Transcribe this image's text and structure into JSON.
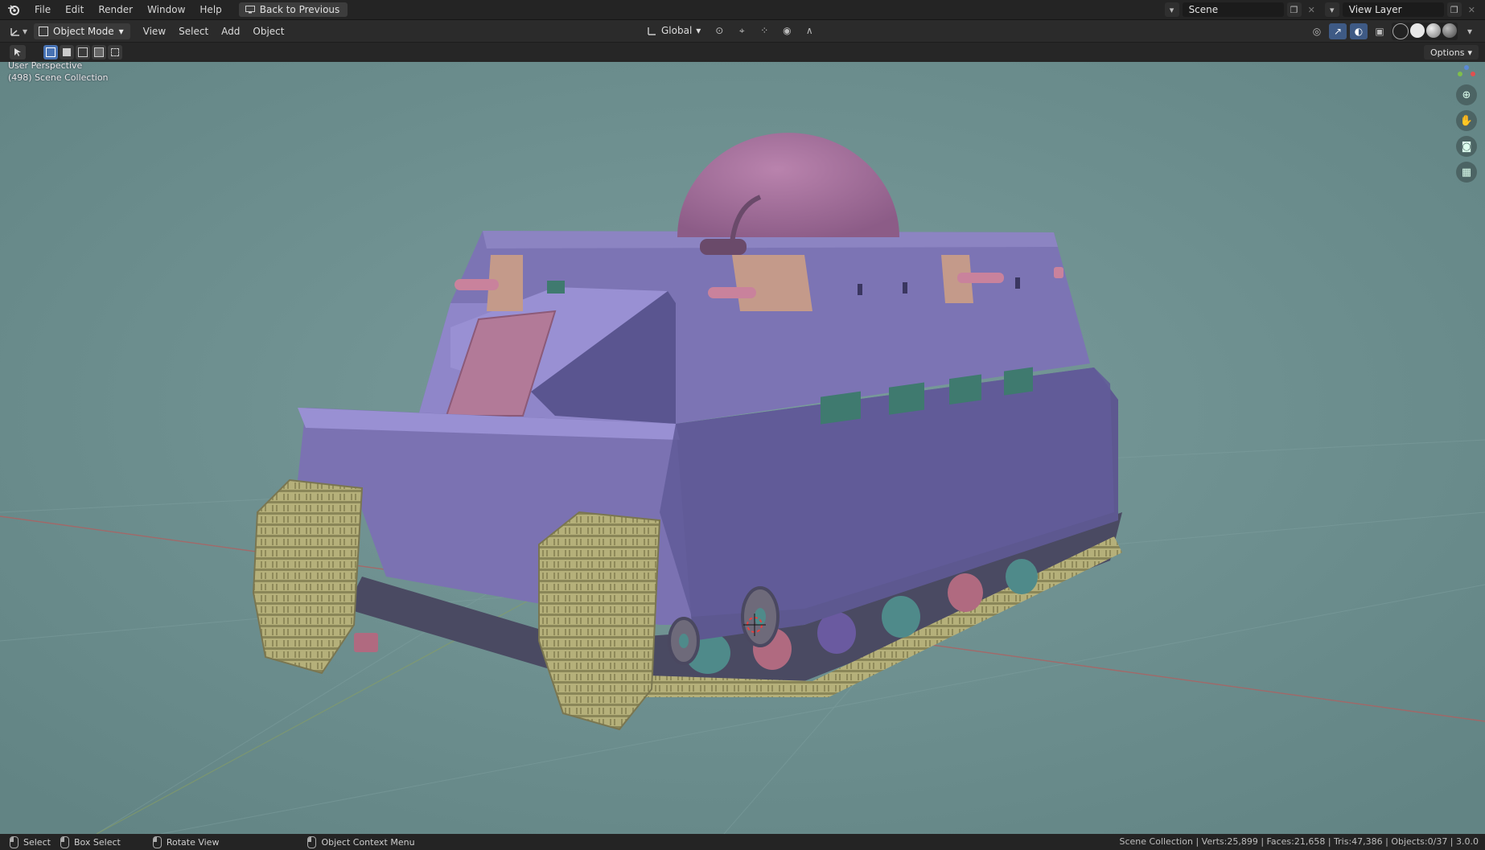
{
  "topbar": {
    "menus": [
      "File",
      "Edit",
      "Render",
      "Window",
      "Help"
    ],
    "back_button": "Back to Previous",
    "scene": "Scene",
    "view_layer": "View Layer"
  },
  "viewport_header": {
    "mode": "Object Mode",
    "menus": [
      "View",
      "Select",
      "Add",
      "Object"
    ],
    "orientation": "Global"
  },
  "tool_header": {
    "options": "Options"
  },
  "viewport": {
    "perspective": "User Perspective",
    "collection": "(498) Scene Collection",
    "background": "#6d8f8f"
  },
  "statusbar": {
    "select": "Select",
    "box_select": "Box Select",
    "rotate_view": "Rotate View",
    "context_menu": "Object Context Menu",
    "stats": "Scene Collection | Verts:25,899 | Faces:21,658 | Tris:47,386 | Objects:0/37 | 3.0.0"
  },
  "colors": {
    "hull": "#7d71b0",
    "hull_side": "#5f5a91",
    "dome": "#a4709c",
    "track": "#b7b27c",
    "accent": "#4772b3"
  }
}
